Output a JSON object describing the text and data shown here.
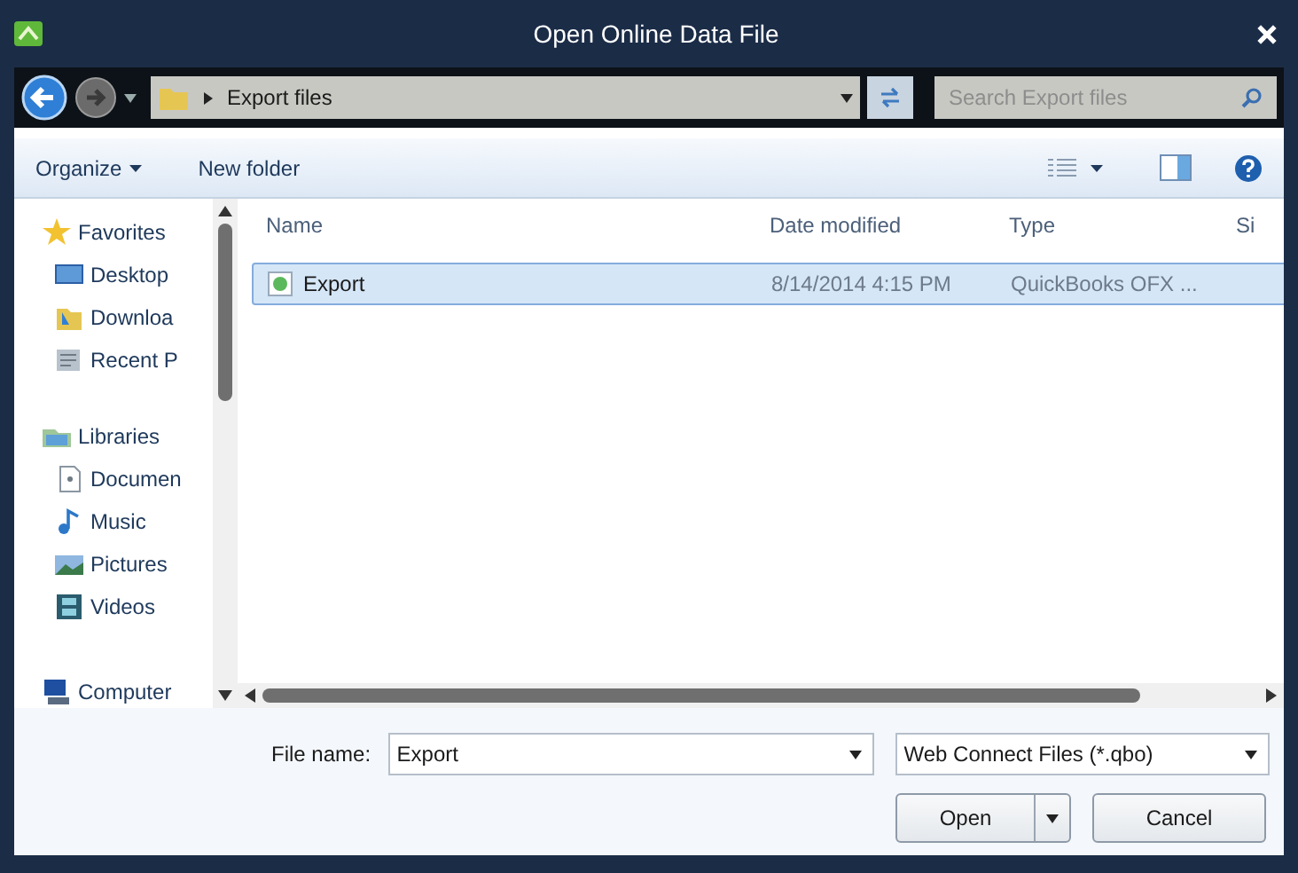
{
  "window": {
    "title": "Open Online Data File"
  },
  "address": {
    "path": "Export files",
    "search_placeholder": "Search Export files"
  },
  "toolbar": {
    "organize": "Organize",
    "new_folder": "New folder"
  },
  "navigation": [
    {
      "label": "Favorites",
      "kind": "star",
      "children": [
        {
          "label": "Desktop",
          "kind": "desktop"
        },
        {
          "label": "Downloa",
          "kind": "downloads"
        },
        {
          "label": "Recent P",
          "kind": "recent"
        }
      ]
    },
    {
      "label": "Libraries",
      "kind": "library",
      "children": [
        {
          "label": "Documen",
          "kind": "document"
        },
        {
          "label": "Music",
          "kind": "music"
        },
        {
          "label": "Pictures",
          "kind": "pictures"
        },
        {
          "label": "Videos",
          "kind": "videos"
        }
      ]
    },
    {
      "label": "Computer",
      "kind": "computer"
    }
  ],
  "table": {
    "columns": [
      "Name",
      "Date modified",
      "Type",
      "Si"
    ],
    "rows": [
      {
        "name": "Export",
        "date_modified": "8/14/2014 4:15 PM",
        "type": "QuickBooks OFX ...",
        "selected": true
      }
    ]
  },
  "file_name": {
    "label": "File name:",
    "value": "Export"
  },
  "file_type": {
    "value": "Web Connect Files (*.qbo)"
  },
  "buttons": {
    "open": "Open",
    "cancel": "Cancel"
  }
}
